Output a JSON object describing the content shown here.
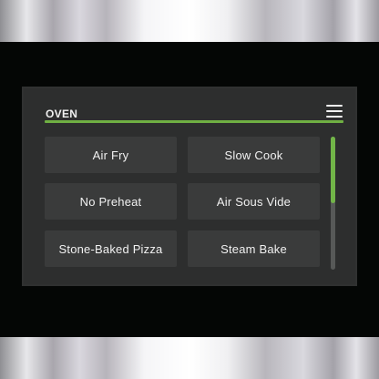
{
  "header": {
    "title": "OVEN",
    "menu_icon": "hamburger-menu-icon"
  },
  "modes": [
    {
      "label": "Air Fry"
    },
    {
      "label": "Slow Cook"
    },
    {
      "label": "No Preheat"
    },
    {
      "label": "Air Sous Vide"
    },
    {
      "label": "Stone-Baked Pizza"
    },
    {
      "label": "Steam Bake"
    }
  ],
  "scrollbar": {
    "position_fraction": 0.0,
    "visible_fraction": 0.5
  },
  "colors": {
    "accent": "#6fb043",
    "screen_background": "#2d2e2e",
    "button_background": "#3a3b3b",
    "text": "#f1f1f1"
  }
}
